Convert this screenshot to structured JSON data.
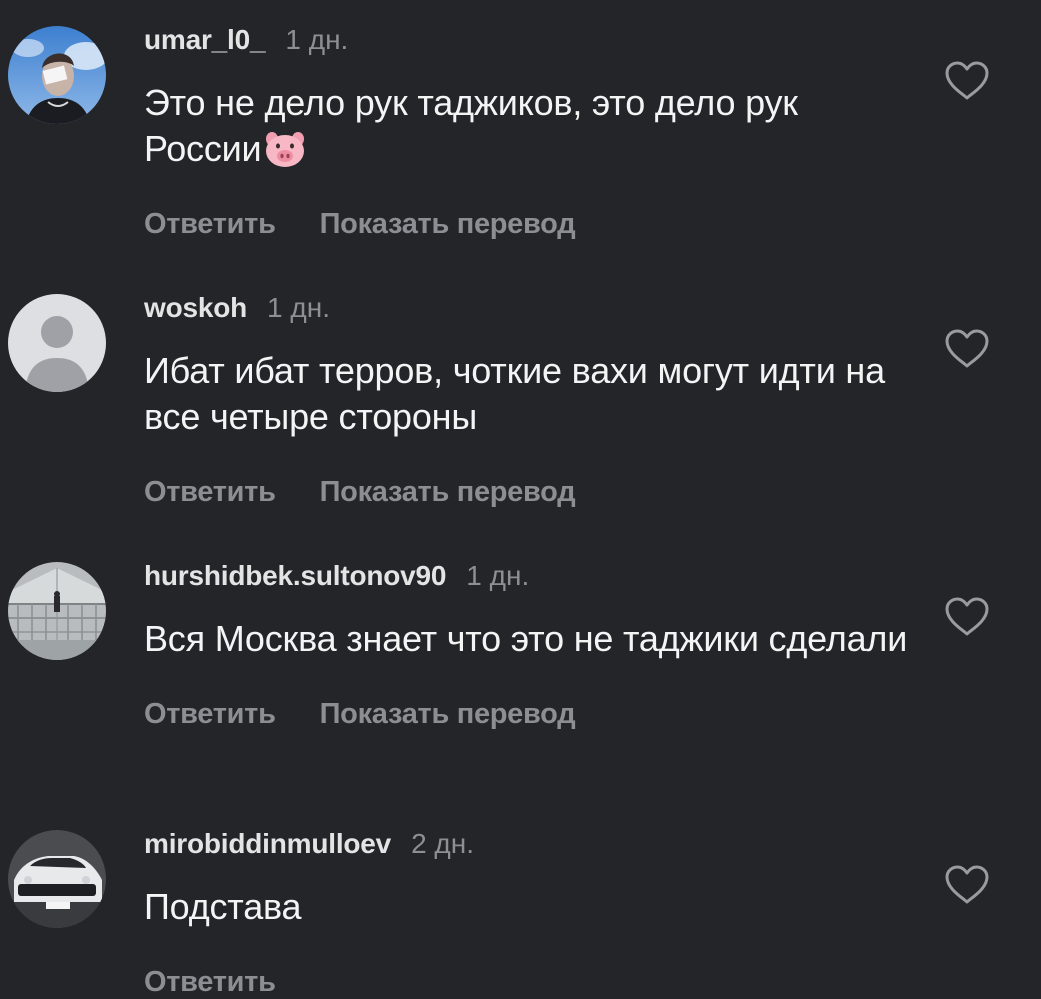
{
  "comments": [
    {
      "username": "umar_l0_",
      "time": "1 дн.",
      "text": "Это не дело рук таджиков, это дело рук России",
      "emoji": "pig-face",
      "actions": [
        "Ответить",
        "Показать перевод"
      ]
    },
    {
      "username": "woskoh",
      "time": "1 дн.",
      "text": "Ибат ибат терров, чоткие вахи могут идти на все четыре стороны",
      "actions": [
        "Ответить",
        "Показать перевод"
      ]
    },
    {
      "username": "hurshidbek.sultonov90",
      "time": "1 дн.",
      "text": "Вся Москва знает что это не таджики сделали",
      "actions": [
        "Ответить",
        "Показать перевод"
      ]
    },
    {
      "username": "mirobiddinmulloev",
      "time": "2 дн.",
      "text": "Подстава",
      "actions": [
        "Ответить"
      ]
    }
  ],
  "icons": {
    "like": "heart-outline-icon",
    "default_avatar": "person-silhouette-icon"
  },
  "colors": {
    "background": "#232529",
    "text": "#f4f4f4",
    "secondary": "#8d8e93"
  }
}
